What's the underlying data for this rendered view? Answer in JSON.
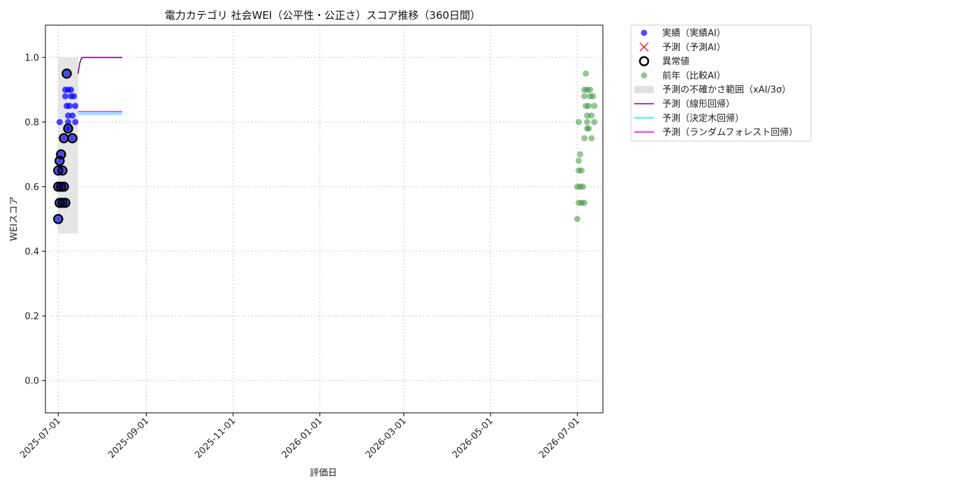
{
  "chart_data": {
    "type": "scatter",
    "title": "電力カテゴリ 社会WEI（公平性・公正さ）スコア推移（360日間）",
    "xlabel": "評価日",
    "ylabel": "WEIスコア",
    "xlim": [
      "2025-06-22",
      "2026-07-19"
    ],
    "ylim": [
      -0.1,
      1.1
    ],
    "grid": true,
    "legend_placement": "outside-top-right",
    "x_ticks": [
      "2025-07-01",
      "2025-09-01",
      "2025-11-01",
      "2026-01-01",
      "2026-03-01",
      "2026-05-01",
      "2026-07-01"
    ],
    "y_ticks": [
      "0.0",
      "0.2",
      "0.4",
      "0.6",
      "0.8",
      "1.0"
    ],
    "y_tick_values": [
      0.0,
      0.2,
      0.4,
      0.6,
      0.8,
      1.0
    ],
    "colors": {
      "actual": "#0000ff",
      "predicted": "#ff0000",
      "anomaly": "#000000",
      "previous": "#2e8b2e",
      "uncertainty": "#d3d3d3",
      "linear": "#800080",
      "tree": "#00ffff",
      "forest": "#ff00ff"
    },
    "legend": [
      {
        "key": "actual",
        "label": "実績（実績AI）"
      },
      {
        "key": "predicted",
        "label": "予測（予測AI）"
      },
      {
        "key": "anomaly",
        "label": "異常値"
      },
      {
        "key": "previous",
        "label": "前年（比較AI）"
      },
      {
        "key": "uncertainty",
        "label": "予測の不確かさ範囲（xAI/3σ）"
      },
      {
        "key": "linear",
        "label": "予測（線形回帰）"
      },
      {
        "key": "tree",
        "label": "予測（決定木回帰）"
      },
      {
        "key": "forest",
        "label": "予測（ランダムフォレスト回帰）"
      }
    ],
    "series": [
      {
        "name": "実績（実績AI）",
        "key": "actual",
        "points": [
          {
            "x": "2025-07-01",
            "y": 0.5
          },
          {
            "x": "2025-07-01",
            "y": 0.6
          },
          {
            "x": "2025-07-01",
            "y": 0.65
          },
          {
            "x": "2025-07-02",
            "y": 0.55
          },
          {
            "x": "2025-07-02",
            "y": 0.68
          },
          {
            "x": "2025-07-02",
            "y": 0.8
          },
          {
            "x": "2025-07-03",
            "y": 0.7
          },
          {
            "x": "2025-07-03",
            "y": 0.6
          },
          {
            "x": "2025-07-04",
            "y": 0.65
          },
          {
            "x": "2025-07-04",
            "y": 0.55
          },
          {
            "x": "2025-07-05",
            "y": 0.6
          },
          {
            "x": "2025-07-05",
            "y": 0.75
          },
          {
            "x": "2025-07-06",
            "y": 0.88
          },
          {
            "x": "2025-07-06",
            "y": 0.55
          },
          {
            "x": "2025-07-06",
            "y": 0.9
          },
          {
            "x": "2025-07-07",
            "y": 0.95
          },
          {
            "x": "2025-07-07",
            "y": 0.85
          },
          {
            "x": "2025-07-07",
            "y": 0.78
          },
          {
            "x": "2025-07-08",
            "y": 0.8
          },
          {
            "x": "2025-07-08",
            "y": 0.9
          },
          {
            "x": "2025-07-08",
            "y": 0.82
          },
          {
            "x": "2025-07-09",
            "y": 0.85
          },
          {
            "x": "2025-07-09",
            "y": 0.78
          },
          {
            "x": "2025-07-10",
            "y": 0.88
          },
          {
            "x": "2025-07-10",
            "y": 0.9
          },
          {
            "x": "2025-07-11",
            "y": 0.82
          },
          {
            "x": "2025-07-11",
            "y": 0.75
          },
          {
            "x": "2025-07-12",
            "y": 0.88
          },
          {
            "x": "2025-07-13",
            "y": 0.85
          },
          {
            "x": "2025-07-13",
            "y": 0.8
          }
        ]
      },
      {
        "name": "異常値",
        "key": "anomaly",
        "points": [
          {
            "x": "2025-07-01",
            "y": 0.5
          },
          {
            "x": "2025-07-01",
            "y": 0.6
          },
          {
            "x": "2025-07-01",
            "y": 0.65
          },
          {
            "x": "2025-07-02",
            "y": 0.55
          },
          {
            "x": "2025-07-02",
            "y": 0.68
          },
          {
            "x": "2025-07-03",
            "y": 0.7
          },
          {
            "x": "2025-07-03",
            "y": 0.6
          },
          {
            "x": "2025-07-04",
            "y": 0.65
          },
          {
            "x": "2025-07-04",
            "y": 0.55
          },
          {
            "x": "2025-07-05",
            "y": 0.6
          },
          {
            "x": "2025-07-05",
            "y": 0.75
          },
          {
            "x": "2025-07-06",
            "y": 0.55
          },
          {
            "x": "2025-07-07",
            "y": 0.95
          },
          {
            "x": "2025-07-08",
            "y": 0.78
          },
          {
            "x": "2025-07-11",
            "y": 0.75
          }
        ]
      },
      {
        "name": "前年（比較AI）",
        "key": "previous",
        "points": [
          {
            "x": "2026-07-01",
            "y": 0.5
          },
          {
            "x": "2026-07-01",
            "y": 0.6
          },
          {
            "x": "2026-07-02",
            "y": 0.65
          },
          {
            "x": "2026-07-02",
            "y": 0.55
          },
          {
            "x": "2026-07-02",
            "y": 0.68
          },
          {
            "x": "2026-07-02",
            "y": 0.8
          },
          {
            "x": "2026-07-03",
            "y": 0.7
          },
          {
            "x": "2026-07-03",
            "y": 0.6
          },
          {
            "x": "2026-07-04",
            "y": 0.65
          },
          {
            "x": "2026-07-04",
            "y": 0.55
          },
          {
            "x": "2026-07-05",
            "y": 0.6
          },
          {
            "x": "2026-07-06",
            "y": 0.75
          },
          {
            "x": "2026-07-06",
            "y": 0.88
          },
          {
            "x": "2026-07-06",
            "y": 0.55
          },
          {
            "x": "2026-07-06",
            "y": 0.9
          },
          {
            "x": "2026-07-07",
            "y": 0.95
          },
          {
            "x": "2026-07-07",
            "y": 0.85
          },
          {
            "x": "2026-07-08",
            "y": 0.78
          },
          {
            "x": "2026-07-08",
            "y": 0.8
          },
          {
            "x": "2026-07-08",
            "y": 0.9
          },
          {
            "x": "2026-07-08",
            "y": 0.82
          },
          {
            "x": "2026-07-09",
            "y": 0.85
          },
          {
            "x": "2026-07-09",
            "y": 0.78
          },
          {
            "x": "2026-07-10",
            "y": 0.88
          },
          {
            "x": "2026-07-10",
            "y": 0.9
          },
          {
            "x": "2026-07-11",
            "y": 0.82
          },
          {
            "x": "2026-07-11",
            "y": 0.75
          },
          {
            "x": "2026-07-12",
            "y": 0.88
          },
          {
            "x": "2026-07-13",
            "y": 0.85
          },
          {
            "x": "2026-07-13",
            "y": 0.8
          }
        ]
      },
      {
        "name": "予測（線形回帰）",
        "key": "linear",
        "line": [
          {
            "x": "2025-07-15",
            "y": 0.95
          },
          {
            "x": "2025-07-16",
            "y": 0.98
          },
          {
            "x": "2025-07-17",
            "y": 0.995
          },
          {
            "x": "2025-07-18",
            "y": 1.0
          },
          {
            "x": "2025-08-15",
            "y": 1.0
          }
        ]
      },
      {
        "name": "予測（決定木回帰）",
        "key": "tree",
        "line": [
          {
            "x": "2025-07-15",
            "y": 0.825
          },
          {
            "x": "2025-08-15",
            "y": 0.825
          }
        ]
      },
      {
        "name": "予測（ランダムフォレスト回帰）",
        "key": "forest",
        "line": [
          {
            "x": "2025-07-15",
            "y": 0.832
          },
          {
            "x": "2025-08-15",
            "y": 0.832
          }
        ]
      }
    ],
    "uncertainty_band": {
      "x0": "2025-07-01",
      "x1": "2025-07-15",
      "y0": 0.455,
      "y1": 1.0
    }
  }
}
